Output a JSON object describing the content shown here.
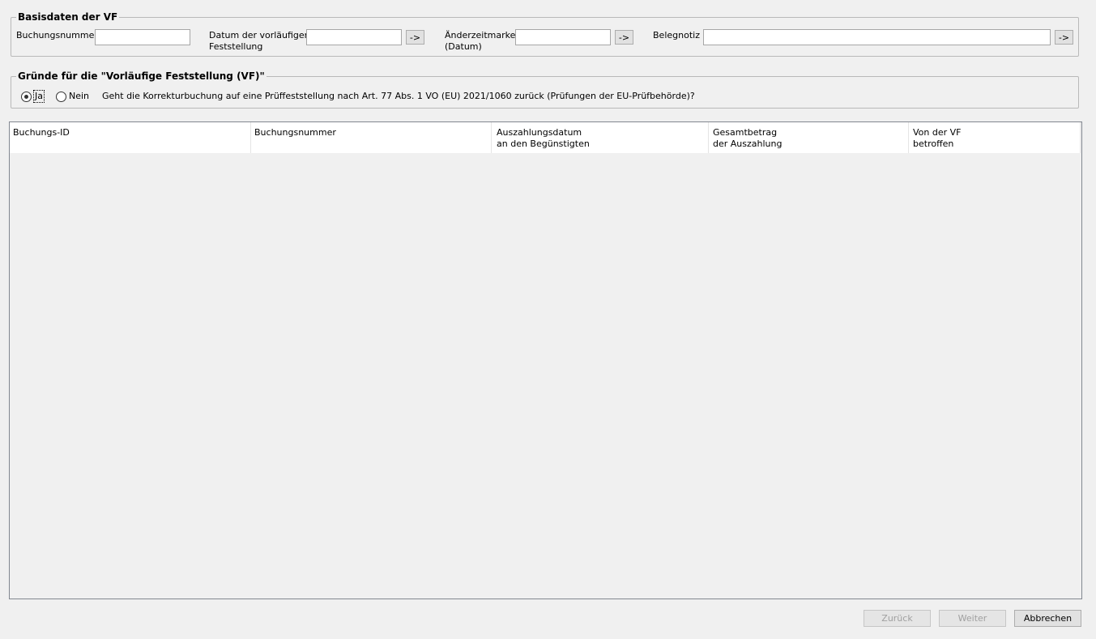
{
  "basisdaten": {
    "title": "Basisdaten der VF",
    "buchungsnummer_label": "Buchungsnummer",
    "buchungsnummer_value": "",
    "datum_label": "Datum der vorläufigen\nFeststellung",
    "datum_value": "",
    "aenderzeitmarke_label": "Änderzeitmarke\n(Datum)",
    "aenderzeitmarke_value": "",
    "belegnotiz_label": "Belegnotiz",
    "belegnotiz_value": "",
    "arrow_label": "->"
  },
  "gruende": {
    "title": "Gründe für die \"Vorläufige Feststellung (VF)\"",
    "ja_label": "Ja",
    "nein_label": "Nein",
    "selected": "Ja",
    "question": "Geht die Korrekturbuchung auf eine Prüffeststellung nach Art. 77 Abs. 1 VO (EU) 2021/1060 zurück (Prüfungen der EU-Prüfbehörde)?"
  },
  "table": {
    "columns": [
      "Buchungs-ID",
      "Buchungsnummer",
      "Auszahlungsdatum\nan den Begünstigten",
      "Gesamtbetrag\nder Auszahlung",
      "Von der VF\nbetroffen"
    ],
    "rows": []
  },
  "footer": {
    "zurueck_label": "Zurück",
    "weiter_label": "Weiter",
    "abbrechen_label": "Abbrechen"
  }
}
